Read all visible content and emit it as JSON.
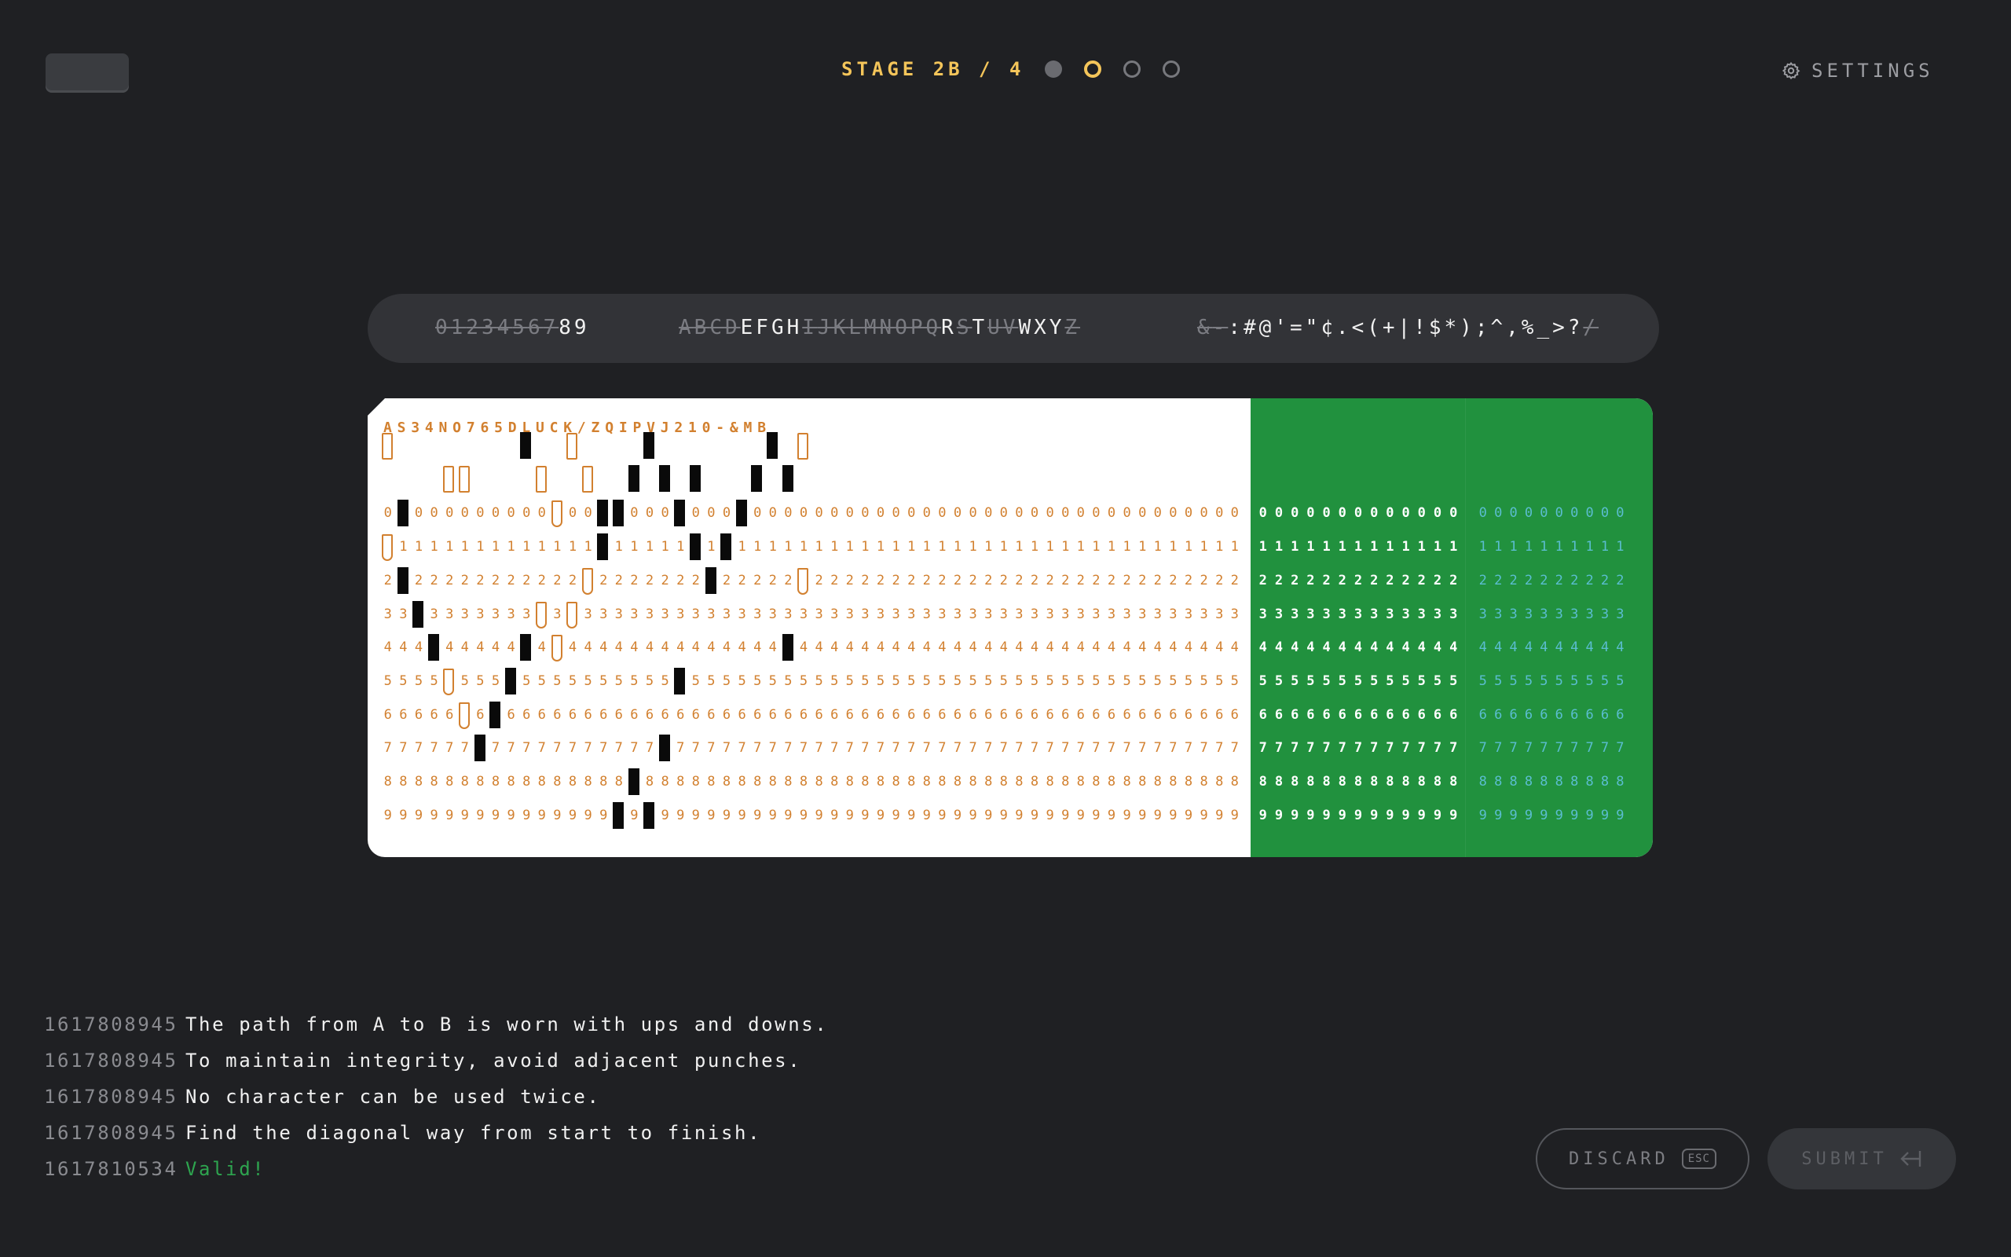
{
  "header": {
    "stage_label": "STAGE 2B / 4",
    "stage_dots": [
      "done",
      "current",
      "pending",
      "pending"
    ],
    "settings_label": "SETTINGS"
  },
  "charset": {
    "digits": {
      "unavailable": "0123456",
      "available": "89"
    },
    "letters": {
      "sequence": "ABCDEFGHIJKLMNOPQRSTUVWXYZ",
      "available": "EFGHRTWXY"
    },
    "symbols": {
      "sequence": "&-:#@'=\"¢.<(+|!$*);^,%_>?/",
      "available": ":#@'=\"¢.<(+|!$*);^,%_>?"
    }
  },
  "card": {
    "header_text": "AS34NO765DLUCK/ZQIPVJ210-&MB",
    "row_labels": [
      "0",
      "1",
      "2",
      "3",
      "4",
      "5",
      "6",
      "7",
      "8",
      "9"
    ],
    "punches": [
      {
        "row": "12",
        "col": 9
      },
      {
        "row": "12",
        "col": 17
      },
      {
        "row": "12",
        "col": 25
      },
      {
        "row": "11",
        "col": 16
      },
      {
        "row": "11",
        "col": 18
      },
      {
        "row": "11",
        "col": 20
      },
      {
        "row": "11",
        "col": 24
      },
      {
        "row": "11",
        "col": 26
      },
      {
        "row": "0",
        "col": 1
      },
      {
        "row": "0",
        "col": 14
      },
      {
        "row": "0",
        "col": 15
      },
      {
        "row": "0",
        "col": 19
      },
      {
        "row": "0",
        "col": 23
      },
      {
        "row": "1",
        "col": 14
      },
      {
        "row": "1",
        "col": 20
      },
      {
        "row": "1",
        "col": 22
      },
      {
        "row": "2",
        "col": 1
      },
      {
        "row": "2",
        "col": 21
      },
      {
        "row": "3",
        "col": 2
      },
      {
        "row": "4",
        "col": 3
      },
      {
        "row": "4",
        "col": 9
      },
      {
        "row": "4",
        "col": 26
      },
      {
        "row": "5",
        "col": 8
      },
      {
        "row": "5",
        "col": 19
      },
      {
        "row": "6",
        "col": 7
      },
      {
        "row": "7",
        "col": 6
      },
      {
        "row": "7",
        "col": 18
      },
      {
        "row": "8",
        "col": 16
      },
      {
        "row": "9",
        "col": 15
      },
      {
        "row": "9",
        "col": 17
      }
    ],
    "holes": [
      {
        "row": "12",
        "col": 0
      },
      {
        "row": "12",
        "col": 12
      },
      {
        "row": "12",
        "col": 27
      },
      {
        "row": "11",
        "col": 4
      },
      {
        "row": "11",
        "col": 5
      },
      {
        "row": "11",
        "col": 10
      },
      {
        "row": "11",
        "col": 13
      },
      {
        "row": "0",
        "col": 11
      },
      {
        "row": "1",
        "col": 0
      },
      {
        "row": "2",
        "col": 13
      },
      {
        "row": "2",
        "col": 27
      },
      {
        "row": "3",
        "col": 10
      },
      {
        "row": "3",
        "col": 12
      },
      {
        "row": "4",
        "col": 11
      },
      {
        "row": "5",
        "col": 4
      },
      {
        "row": "6",
        "col": 5
      }
    ]
  },
  "log": [
    {
      "ts": "1617808945",
      "msg": "The path from A to B is worn with ups and downs.",
      "ok": false
    },
    {
      "ts": "1617808945",
      "msg": "To maintain integrity, avoid adjacent punches.",
      "ok": false
    },
    {
      "ts": "1617808945",
      "msg": "No character can be used twice.",
      "ok": false
    },
    {
      "ts": "1617808945",
      "msg": "Find the diagonal way from start to finish.",
      "ok": false
    },
    {
      "ts": "1617810534",
      "msg": "Valid!",
      "ok": true
    }
  ],
  "actions": {
    "discard_label": "DISCARD",
    "discard_key": "ESC",
    "submit_label": "SUBMIT"
  },
  "colors": {
    "accent": "#f4c55a",
    "card_ink": "#d2802f",
    "card_green": "#21913e",
    "valid": "#2ea44f"
  }
}
